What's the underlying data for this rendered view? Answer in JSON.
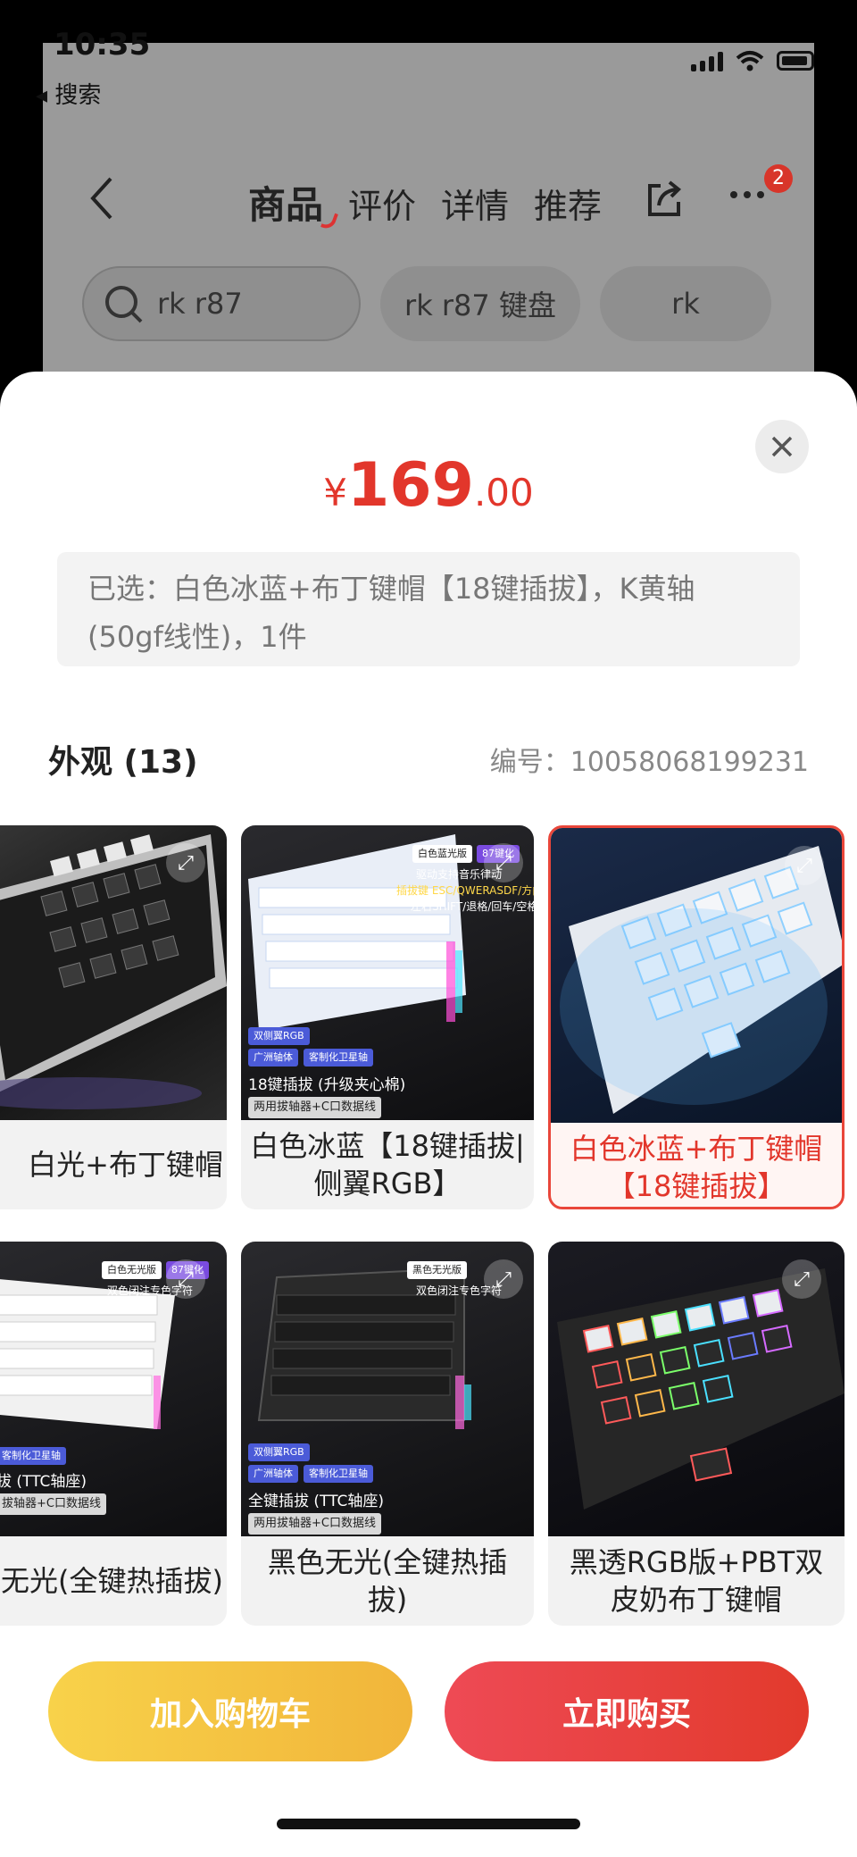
{
  "status_bar": {
    "time": "10:35",
    "back_app": "搜索"
  },
  "nav": {
    "tabs": [
      {
        "label": "商品",
        "active": true
      },
      {
        "label": "评价",
        "active": false
      },
      {
        "label": "详情",
        "active": false
      },
      {
        "label": "推荐",
        "active": false
      }
    ],
    "more_badge": "2"
  },
  "search_chips": [
    "rk r87",
    "rk r87 键盘",
    "rk"
  ],
  "sheet": {
    "price": {
      "currency": "¥",
      "integer": "169",
      "decimal": ".00"
    },
    "selected_text": "已选：白色冰蓝+布丁键帽【18键插拔】，K黄轴(50gf线性)，1件",
    "section_title": "外观 (13)",
    "sku": "编号：10058068199231",
    "variants": [
      {
        "label": "白光+布丁键帽",
        "selected": false,
        "promo": []
      },
      {
        "label": "白色冰蓝【18键插拔|侧翼RGB】",
        "selected": false,
        "promo": [
          "白色蓝光版",
          "87键化",
          "驱动支持音乐律动",
          "插拔键 ESC/QWERASDF/方向键",
          "左右SHIFT/退格/回车/空格",
          "双侧翼RGB",
          "广洲轴体",
          "客制化卫星轴",
          "18键插拔 (升级夹心棉)",
          "两用拔轴器+C口数据线"
        ]
      },
      {
        "label": "白色冰蓝+布丁键帽【18键插拔】",
        "selected": true,
        "promo": []
      },
      {
        "label": "色无光(全键热插拔)",
        "selected": false,
        "promo": [
          "白色无光版",
          "87键化",
          "双色闭注专色字符",
          "客制化卫星轴",
          "拔 (TTC轴座)",
          "拔轴器+C口数据线"
        ]
      },
      {
        "label": "黑色无光(全键热插拔)",
        "selected": false,
        "promo": [
          "黑色无光版",
          "双色闭注专色字符",
          "双侧翼RGB",
          "广洲轴体",
          "客制化卫星轴",
          "全键插拔 (TTC轴座)",
          "两用拔轴器+C口数据线"
        ]
      },
      {
        "label": "黑透RGB版+PBT双皮奶布丁键帽",
        "selected": false,
        "promo": []
      }
    ],
    "buttons": {
      "cart": "加入购物车",
      "buy": "立即购买"
    }
  },
  "colors": {
    "accent_red": "#e2362b",
    "cart_yellow": "#f4c242",
    "buy_red": "#e8403e"
  }
}
